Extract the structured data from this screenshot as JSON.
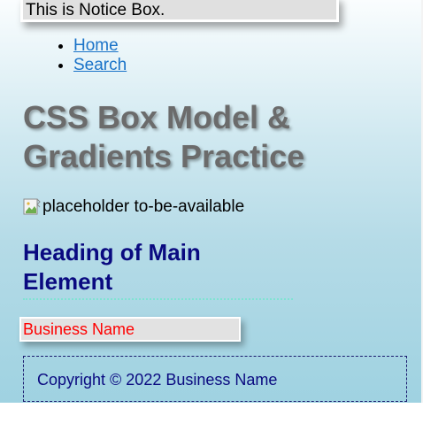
{
  "notice": {
    "text": "This is Notice Box."
  },
  "nav": {
    "items": [
      {
        "label": "Home"
      },
      {
        "label": "Search"
      }
    ]
  },
  "page": {
    "title": "CSS Box Model & Gradients Practice"
  },
  "image": {
    "alt": "placeholder to-be-available",
    "icon": "broken-image-icon"
  },
  "main": {
    "heading": "Heading of Main Element"
  },
  "business": {
    "name": "Business Name"
  },
  "footer": {
    "copyright": "Copyright © 2022 Business Name"
  },
  "colors": {
    "link": "#1a73c8",
    "heading": "#0a0a80",
    "business_text": "#ff0000",
    "title": "#6b6b6b",
    "dotted_border": "#7fe3d3"
  }
}
